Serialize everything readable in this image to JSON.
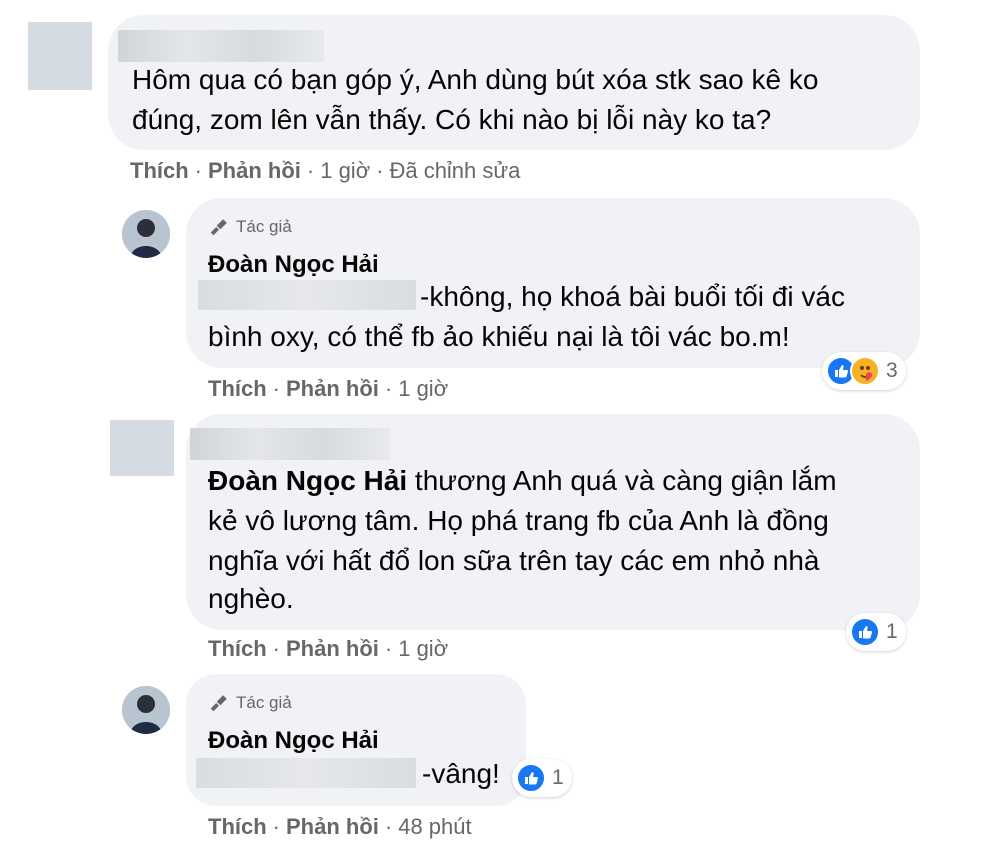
{
  "comments": [
    {
      "name": "",
      "text_lines": [
        "Hôm qua có bạn góp ý, Anh dùng bút xóa stk sao kê ko",
        "đúng, zom lên vẫn thấy. Có khi nào bị lỗi này ko ta?"
      ],
      "actions": {
        "like": "Thích",
        "reply": "Phản hồi",
        "time": "1 giờ",
        "edited": "Đã chỉnh sửa"
      }
    },
    {
      "author_badge": "Tác giả",
      "name": "Đoàn Ngọc Hải",
      "text_lines": [
        "-không, họ khoá bài buổi tối đi vác",
        "bình oxy, có thể fb ảo khiếu nại là tôi vác bo.m!"
      ],
      "reactions": {
        "count": "3",
        "types": [
          "like-icon",
          "care-icon"
        ]
      },
      "actions": {
        "like": "Thích",
        "reply": "Phản hồi",
        "time": "1 giờ"
      }
    },
    {
      "name": "",
      "tag_name": "Đoàn Ngọc Hải",
      "text_lines": [
        " thương Anh quá và càng giận lắm",
        "kẻ vô lương tâm. Họ phá trang fb của Anh là đồng",
        "nghĩa với hất đổ lon sữa trên tay các em nhỏ nhà",
        "nghèo."
      ],
      "reactions": {
        "count": "1",
        "types": [
          "like-icon"
        ]
      },
      "actions": {
        "like": "Thích",
        "reply": "Phản hồi",
        "time": "1 giờ"
      }
    },
    {
      "author_badge": "Tác giả",
      "name": "Đoàn Ngọc Hải",
      "text_lines": [
        "-vâng!"
      ],
      "reactions": {
        "count": "1",
        "types": [
          "like-icon"
        ]
      },
      "actions": {
        "like": "Thích",
        "reply": "Phản hồi",
        "time": "48 phút"
      }
    }
  ],
  "colors": {
    "bubble": "#f0f2f5",
    "meta": "#65676b",
    "like": "#1877f2",
    "care": "#f7b125"
  }
}
